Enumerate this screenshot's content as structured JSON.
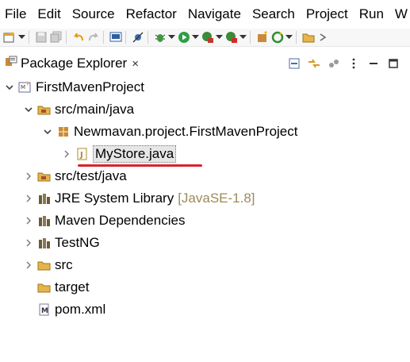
{
  "menu": [
    "File",
    "Edit",
    "Source",
    "Refactor",
    "Navigate",
    "Search",
    "Project",
    "Run",
    "W"
  ],
  "toolbar": {
    "icons": [
      "new-icon",
      "save-icon",
      "save-all-icon",
      "undo-icon",
      "redo-icon",
      "console-icon",
      "debug-bug-icon",
      "run-icon",
      "external-tools-icon",
      "new-package-icon",
      "refresh-icon",
      "open-folder-icon"
    ]
  },
  "view": {
    "title": "Package Explorer",
    "close": "×"
  },
  "tree": {
    "project": "FirstMavenProject",
    "src_main_java": "src/main/java",
    "package": "Newmavan.project.FirstMavenProject",
    "file_selected": "MyStore.java",
    "src_test_java": "src/test/java",
    "jre": "JRE System Library",
    "jre_version": "[JavaSE-1.8]",
    "maven_deps": "Maven Dependencies",
    "testng": "TestNG",
    "src": "src",
    "target": "target",
    "pom": "pom.xml"
  },
  "colors": {
    "underline": "#d9232c",
    "selection": "#e6e6e6",
    "decoration": "#9c8a5a"
  }
}
